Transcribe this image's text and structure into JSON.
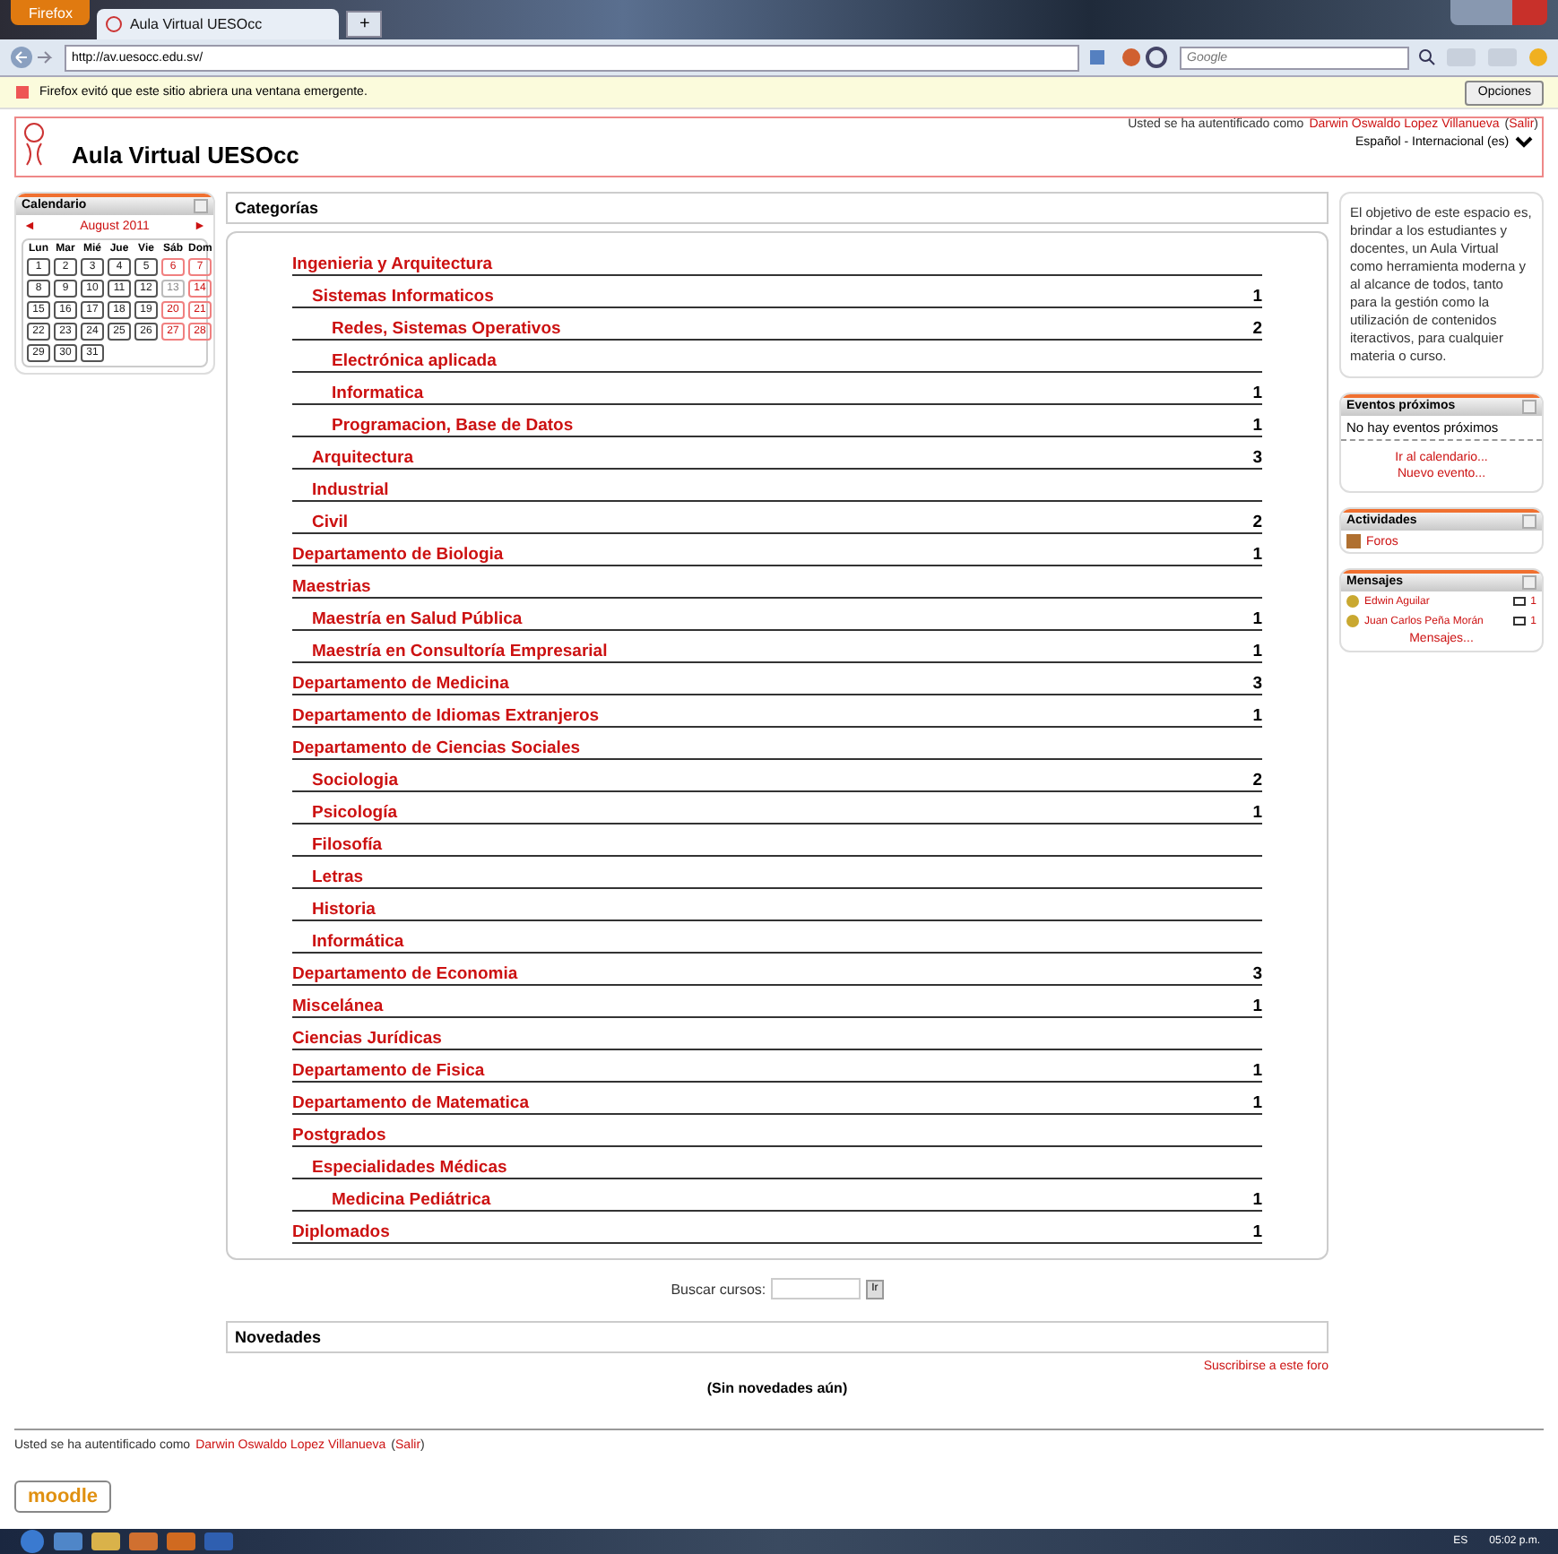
{
  "browser": {
    "menu_button": "Firefox",
    "tab_title": "Aula Virtual UESOcc",
    "new_tab": "+",
    "address": "http://av.uesocc.edu.sv/",
    "search_placeholder": "Google"
  },
  "notification": {
    "text": "Firefox evitó que este sitio abriera una ventana emergente.",
    "button": "Opciones"
  },
  "header": {
    "site_name": "Aula Virtual UESOcc",
    "login_prefix": "Usted se ha autentificado como",
    "user": "Darwin Oswaldo Lopez Villanueva",
    "paren_open": "(",
    "logout": "Salir",
    "paren_close": ")",
    "language": "Español - Internacional (es)"
  },
  "calendar": {
    "title": "Calendario",
    "prev": "◄",
    "month": "August 2011",
    "next": "►",
    "weekdays": [
      "Lun",
      "Mar",
      "Mié",
      "Jue",
      "Vie",
      "Sáb",
      "Dom"
    ],
    "days": [
      {
        "label": "1",
        "kind": "weekday"
      },
      {
        "label": "2",
        "kind": "weekday"
      },
      {
        "label": "3",
        "kind": "weekday"
      },
      {
        "label": "4",
        "kind": "weekday"
      },
      {
        "label": "5",
        "kind": "weekday"
      },
      {
        "label": "6",
        "kind": "weekend"
      },
      {
        "label": "7",
        "kind": "weekend"
      },
      {
        "label": "8",
        "kind": "weekday"
      },
      {
        "label": "9",
        "kind": "weekday"
      },
      {
        "label": "10",
        "kind": "weekday"
      },
      {
        "label": "11",
        "kind": "weekday"
      },
      {
        "label": "12",
        "kind": "weekday"
      },
      {
        "label": "13",
        "kind": "today"
      },
      {
        "label": "14",
        "kind": "weekend"
      },
      {
        "label": "15",
        "kind": "weekday"
      },
      {
        "label": "16",
        "kind": "weekday"
      },
      {
        "label": "17",
        "kind": "weekday"
      },
      {
        "label": "18",
        "kind": "weekday"
      },
      {
        "label": "19",
        "kind": "weekday"
      },
      {
        "label": "20",
        "kind": "weekend"
      },
      {
        "label": "21",
        "kind": "weekend"
      },
      {
        "label": "22",
        "kind": "weekday"
      },
      {
        "label": "23",
        "kind": "weekday"
      },
      {
        "label": "24",
        "kind": "weekday"
      },
      {
        "label": "25",
        "kind": "weekday"
      },
      {
        "label": "26",
        "kind": "weekday"
      },
      {
        "label": "27",
        "kind": "weekend"
      },
      {
        "label": "28",
        "kind": "weekend"
      },
      {
        "label": "29",
        "kind": "weekday"
      },
      {
        "label": "30",
        "kind": "weekday"
      },
      {
        "label": "31",
        "kind": "weekday"
      }
    ]
  },
  "categories": {
    "title": "Categorías",
    "items": [
      {
        "name": "Ingenieria y Arquitectura",
        "children": [
          {
            "name": "Sistemas Informaticos",
            "count": "1",
            "children": [
              {
                "name": "Redes, Sistemas Operativos",
                "count": "2"
              },
              {
                "name": "Electrónica aplicada"
              },
              {
                "name": "Informatica",
                "count": "1"
              },
              {
                "name": "Programacion, Base de Datos",
                "count": "1"
              }
            ]
          },
          {
            "name": "Arquitectura",
            "count": "3"
          },
          {
            "name": "Industrial"
          },
          {
            "name": "Civil",
            "count": "2"
          }
        ]
      },
      {
        "name": "Departamento de Biologia",
        "count": "1"
      },
      {
        "name": "Maestrias",
        "children": [
          {
            "name": "Maestría en Salud Pública",
            "count": "1"
          },
          {
            "name": "Maestría en Consultoría Empresarial",
            "count": "1"
          }
        ]
      },
      {
        "name": "Departamento de Medicina",
        "count": "3"
      },
      {
        "name": "Departamento de Idiomas Extranjeros",
        "count": "1"
      },
      {
        "name": "Departamento de Ciencias Sociales",
        "children": [
          {
            "name": "Sociologia",
            "count": "2"
          },
          {
            "name": "Psicología",
            "count": "1"
          },
          {
            "name": "Filosofía"
          },
          {
            "name": "Letras"
          },
          {
            "name": "Historia"
          },
          {
            "name": "Informática"
          }
        ]
      },
      {
        "name": "Departamento de Economia",
        "count": "3"
      },
      {
        "name": "Miscelánea",
        "count": "1"
      },
      {
        "name": "Ciencias Jurídicas"
      },
      {
        "name": "Departamento de Fisica",
        "count": "1"
      },
      {
        "name": "Departamento de Matematica",
        "count": "1"
      },
      {
        "name": "Postgrados",
        "children": [
          {
            "name": "Especialidades Médicas",
            "children": [
              {
                "name": "Medicina Pediátrica",
                "count": "1"
              }
            ]
          }
        ]
      },
      {
        "name": "Diplomados",
        "count": "1"
      }
    ]
  },
  "search": {
    "label": "Buscar cursos:",
    "button": "Ir"
  },
  "news": {
    "title": "Novedades",
    "subscribe": "Suscribirse a este foro",
    "empty": "(Sin novedades aún)"
  },
  "about": "El objetivo de este espacio es, brindar a los estudiantes y docentes, un Aula Virtual como herramienta moderna y al alcance de todos, tanto para la gestión como la utilización de contenidos iteractivos, para cualquier materia o curso.",
  "events": {
    "title": "Eventos próximos",
    "empty": "No hay eventos próximos",
    "links": [
      "Ir al calendario...",
      "Nuevo evento..."
    ]
  },
  "activities": {
    "title": "Actividades",
    "items": [
      "Foros"
    ]
  },
  "messages": {
    "title": "Mensajes",
    "items": [
      {
        "name": "Edwin Aguilar",
        "count": "1"
      },
      {
        "name": "Juan Carlos Peña Morán",
        "count": "1"
      }
    ],
    "link": "Mensajes..."
  },
  "footer": {
    "login_prefix": "Usted se ha autentificado como",
    "user": "Darwin Oswaldo Lopez Villanueva",
    "paren_open": "(",
    "logout": "Salir",
    "paren_close": ")",
    "logo": "moodle"
  },
  "taskbar": {
    "language": "ES",
    "time": "05:02 p.m."
  }
}
